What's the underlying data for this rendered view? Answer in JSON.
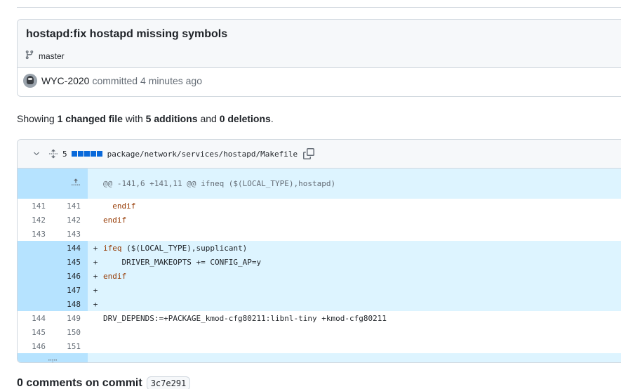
{
  "commit": {
    "title": "hostapd:fix hostapd missing symbols",
    "branch": "master",
    "author": "WYC-2020",
    "committed_text": "committed",
    "time_ago": "4 minutes ago"
  },
  "summary": {
    "prefix": "Showing",
    "changed": "1 changed file",
    "with": "with",
    "additions": "5 additions",
    "and": "and",
    "deletions": "0 deletions",
    "period": "."
  },
  "file": {
    "change_count": "5",
    "path": "package/network/services/hostapd/Makefile",
    "hunk_header": "@@ -141,6 +141,11 @@ ifneq ($(LOCAL_TYPE),hostapd)",
    "lines": [
      {
        "old": "141",
        "new": "141",
        "marker": "",
        "code": "  endif",
        "type": "context"
      },
      {
        "old": "142",
        "new": "142",
        "marker": "",
        "code": "endif",
        "type": "context"
      },
      {
        "old": "143",
        "new": "143",
        "marker": "",
        "code": "",
        "type": "context"
      },
      {
        "old": "",
        "new": "144",
        "marker": "+",
        "code": "ifeq ($(LOCAL_TYPE),supplicant)",
        "type": "add"
      },
      {
        "old": "",
        "new": "145",
        "marker": "+",
        "code": "    DRIVER_MAKEOPTS += CONFIG_AP=y",
        "type": "add"
      },
      {
        "old": "",
        "new": "146",
        "marker": "+",
        "code": "endif",
        "type": "add"
      },
      {
        "old": "",
        "new": "147",
        "marker": "+",
        "code": "",
        "type": "add"
      },
      {
        "old": "",
        "new": "148",
        "marker": "+",
        "code": "",
        "type": "add"
      },
      {
        "old": "144",
        "new": "149",
        "marker": "",
        "code": "DRV_DEPENDS:=+PACKAGE_kmod-cfg80211:libnl-tiny +kmod-cfg80211",
        "type": "context"
      },
      {
        "old": "145",
        "new": "150",
        "marker": "",
        "code": "",
        "type": "context"
      },
      {
        "old": "146",
        "new": "151",
        "marker": "",
        "code": "",
        "type": "context"
      }
    ]
  },
  "comments": {
    "label": "0 comments on commit",
    "sha": "3c7e291"
  }
}
